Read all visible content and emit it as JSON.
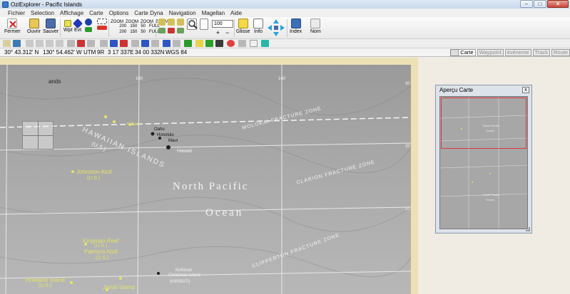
{
  "window": {
    "title": "OziExplorer - Pacific Islands"
  },
  "window_buttons": {
    "minimize": "–",
    "maximize": "□",
    "close": "✕"
  },
  "menu": [
    "Fichier",
    "Selection",
    "Affichage",
    "Carte",
    "Options",
    "Carte Dyna",
    "Navigation",
    "Magellan",
    "Aide"
  ],
  "toolbar": {
    "fermer": "Fermer",
    "ouvrir": "Ouvrir",
    "sauver": "Sauver",
    "wpt": "Wpt",
    "evt": "Evt",
    "zoom_value": "100",
    "glisse": "Glisse",
    "info": "Info",
    "index": "Index",
    "nom": "Nom",
    "zoom_labels": [
      "ZOOM",
      "ZOOM",
      "ZOOM",
      "ZOOM"
    ],
    "zoom_values": [
      "200",
      "150",
      "50",
      "FULL"
    ],
    "zoom_values2": [
      "200",
      "150",
      "50",
      "FULL"
    ]
  },
  "status": {
    "lat": "30° 43.312' N",
    "lon": "130° 54.462' W",
    "utm_label": "UTM",
    "zone": "9R",
    "easting": "3 17 337E",
    "northing": "34 00 332N",
    "datum": "WGS 84"
  },
  "tabs": [
    "Carte",
    "Waypoint",
    "événeme",
    "Track",
    "Route"
  ],
  "map": {
    "labels": {
      "hawaiian": "HAWAIIAN ISLANDS",
      "us": "(U.S.)",
      "molokai": "MOLOKAI FRACTURE ZONE",
      "clarion": "CLARION FRACTURE ZONE",
      "clipperton": "CLIPPERTON FRACTURE ZONE",
      "north_pacific": "North Pacific",
      "ocean": "Ocean",
      "johnston": "Johnston Atoll",
      "johnston_us": "(U.S.)",
      "kingman": "Kingman Reef",
      "kingman_us": "(U.S.)",
      "palmyra": "Palmyra Atoll",
      "palmyra_us": "(U.S.)",
      "howland": "Howland Island",
      "howland_us": "(U.S.)",
      "jarvis": "Jarvis Island",
      "honolulu": "Honolulu",
      "oahu": "Oahu",
      "maui": "Maui",
      "hawaii": "Hawaii",
      "niihau": "Niihau",
      "lands": "ands",
      "lon160": "160",
      "lon140": "140",
      "lat30": "30",
      "lat20": "20",
      "lat10": "10",
      "kiritimati": "Christmas Island",
      "kiribati": "(KIRIBATI)",
      "kiritimati2": "Kiritimati"
    }
  },
  "preview_panel": {
    "title": "Aperçu Carte",
    "close": "x",
    "labels": [
      "North Pacific",
      "Ocean",
      "South Pacific",
      "Ocean"
    ]
  },
  "colors": {
    "selection_box": "#d83a3a",
    "atoll_label": "#e4e36a",
    "map_frame": "#ece0b6"
  }
}
